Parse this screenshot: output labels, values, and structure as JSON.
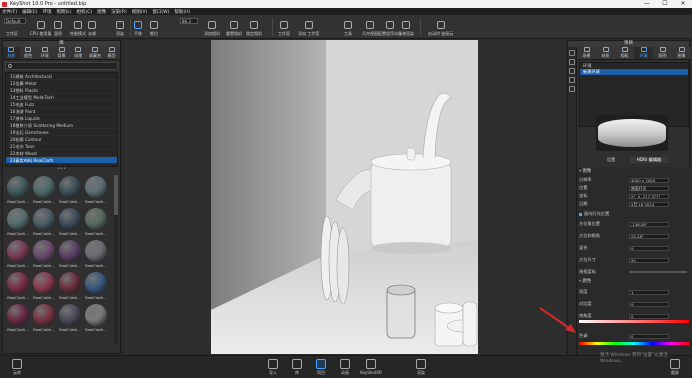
{
  "window": {
    "title": "KeyShot 10.0 Pro - untitled.bip",
    "controls": [
      "—",
      "☐",
      "✕"
    ]
  },
  "menu": [
    "文件(F)",
    "编辑(E)",
    "环境",
    "照明(L)",
    "相机(C)",
    "图像",
    "渲染(R)",
    "视图(V)",
    "窗口(W)",
    "帮助(H)"
  ],
  "toolbar": {
    "workspace_combo": "Default",
    "zoom_value": "86.3",
    "tools": [
      "工作区",
      "CPU 使用量",
      "暂停",
      "性能模式",
      "去噪",
      "渲染",
      "平移",
      "推拉",
      "添加相机",
      "重置相机",
      "锁定相机",
      "工作室",
      "添加 工作室",
      "工具",
      "几何视图",
      "配置程序向导",
      "光谱渲染",
      "启动时 链接云",
      "设置"
    ]
  },
  "left_panel": {
    "header": "库",
    "tabs": [
      "材质",
      "颜色",
      "环境",
      "背景",
      "纹理",
      "收藏夹",
      "模型"
    ],
    "tree": [
      "11建筑 Architectural",
      "12金属 Metal",
      "13塑料 Plastic",
      "14工业模型 Mold-Tech",
      "15毛皮 Fuzz",
      "16油漆 Paint",
      "17液体 Liquids",
      "18散射介质 Scattering Medium",
      "19宝石 Gemstones",
      "20轮廓 Contour",
      "21毛巾 Toon",
      "22木材 Wood",
      "23真实布料 RealCloth"
    ],
    "selected_index": 12,
    "thumb_label": "RealCloth...",
    "thumb_colors": [
      "#3f5a5c",
      "#4d6a6a",
      "#3b4e57",
      "#5b6e74",
      "#566d6d",
      "#4c5c66",
      "#3e4c5a",
      "#566a5e",
      "#7a3b56",
      "#6a4a70",
      "#5c4066",
      "#6b6b72",
      "#7b2e4a",
      "#8a3a4f",
      "#6a2f3d",
      "#3a5880",
      "#6c2a45",
      "#7a3344",
      "#4a4a5a",
      "#7a7a7a"
    ]
  },
  "right_panel": {
    "header": "项目",
    "tabs": [
      "场景",
      "材质",
      "相机",
      "环境",
      "照明",
      "图像"
    ],
    "tree": [
      "环境",
      "新建环境"
    ],
    "selected_tree_index": 1,
    "subtabs": [
      "设置",
      "HDRI 编辑器"
    ],
    "active_subtab": 1,
    "sections": {
      "image": "图像",
      "color": "颜色"
    },
    "props": [
      {
        "label": "分辨率",
        "value": "4000 x 2000"
      },
      {
        "label": "位置",
        "value": "曲面灯光"
      },
      {
        "label": "坐标",
        "value": "X°, 0, 217.377°"
      },
      {
        "label": "日期",
        "value": "5月 16 2024"
      }
    ],
    "checkbox_label": "面向灯光位置",
    "props2": [
      {
        "label": "方位角位置",
        "value": "-136.58°"
      },
      {
        "label": "方位仰角角",
        "value": "55.28°"
      },
      {
        "label": "混合",
        "value": "0"
      },
      {
        "label": "方位尺寸",
        "value": "50"
      },
      {
        "label": "线框度标",
        "value": ""
      }
    ],
    "props3": [
      {
        "label": "亮度",
        "value": "1"
      },
      {
        "label": "对比度",
        "value": "0"
      },
      {
        "label": "饱和度",
        "value": "0"
      },
      {
        "label": "色调",
        "value": "0"
      }
    ]
  },
  "bottom_bar": {
    "left_label": "云库",
    "tools": [
      "导入",
      "库",
      "项目",
      "动画",
      "KeyShotXR",
      "渲染"
    ],
    "active_index": 2,
    "right_label": "截屏"
  },
  "watermark": "激活 Windows 转到\"设置\"以激活 Windows。"
}
